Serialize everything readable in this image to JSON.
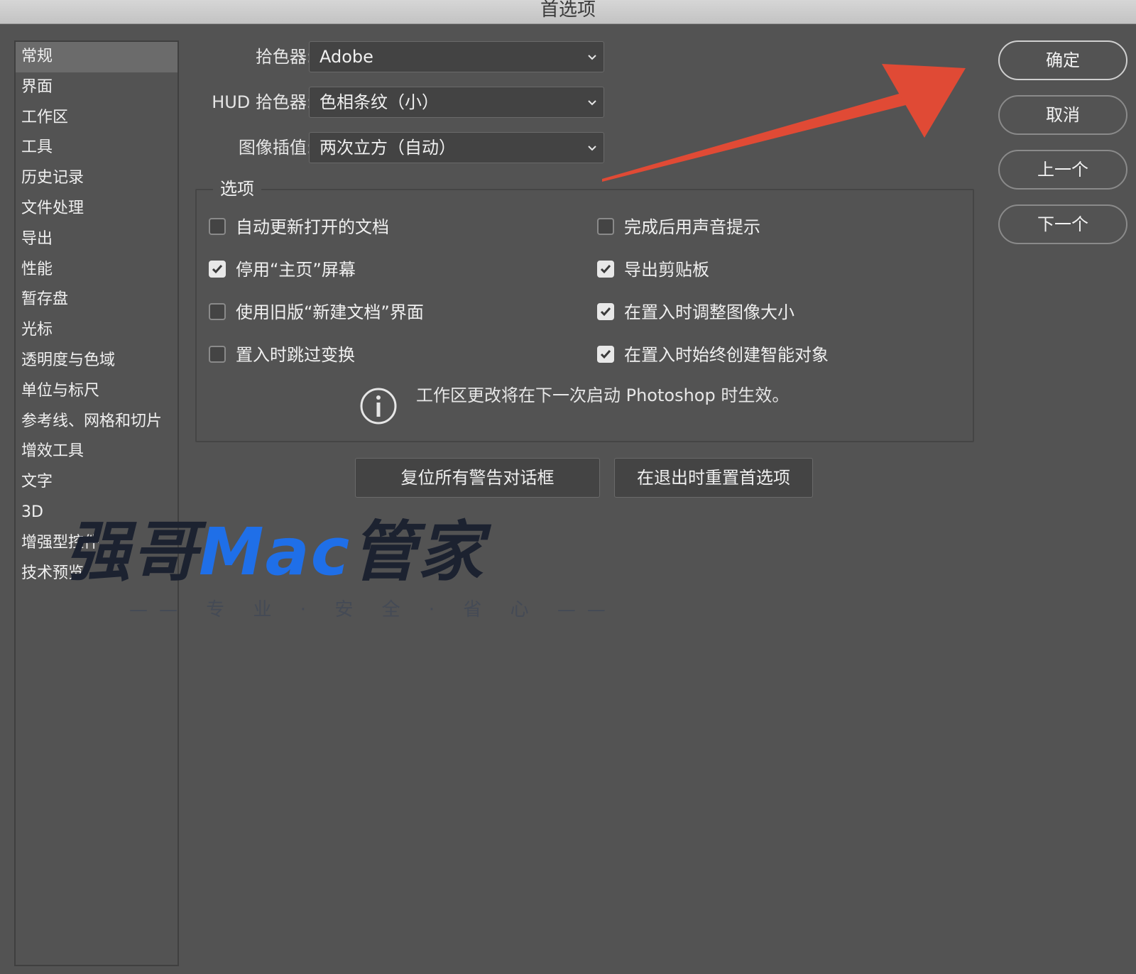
{
  "window": {
    "title": "首选项"
  },
  "sidebar": {
    "items": [
      {
        "label": "常规",
        "selected": true
      },
      {
        "label": "界面"
      },
      {
        "label": "工作区"
      },
      {
        "label": "工具"
      },
      {
        "label": "历史记录"
      },
      {
        "label": "文件处理"
      },
      {
        "label": "导出"
      },
      {
        "label": "性能"
      },
      {
        "label": "暂存盘"
      },
      {
        "label": "光标"
      },
      {
        "label": "透明度与色域"
      },
      {
        "label": "单位与标尺"
      },
      {
        "label": "参考线、网格和切片"
      },
      {
        "label": "增效工具"
      },
      {
        "label": "文字"
      },
      {
        "label": "3D"
      },
      {
        "label": "增强型控件"
      },
      {
        "label": "技术预览"
      }
    ]
  },
  "fields": {
    "color_picker": {
      "label": "拾色器:",
      "value": "Adobe"
    },
    "hud_color_picker": {
      "label": "HUD 拾色器:",
      "value": "色相条纹（小）"
    },
    "image_interpolation": {
      "label": "图像插值:",
      "value": "两次立方（自动）"
    }
  },
  "options": {
    "title": "选项",
    "auto_update_docs": {
      "label": "自动更新打开的文档",
      "checked": false
    },
    "disable_home_screen": {
      "label": "停用“主页”屏幕",
      "checked": true
    },
    "legacy_new_doc": {
      "label": "使用旧版“新建文档”界面",
      "checked": false
    },
    "skip_transform_on_place": {
      "label": "置入时跳过变换",
      "checked": false
    },
    "beep_when_done": {
      "label": "完成后用声音提示",
      "checked": false
    },
    "export_clipboard": {
      "label": "导出剪贴板",
      "checked": true
    },
    "resize_on_place": {
      "label": "在置入时调整图像大小",
      "checked": true
    },
    "always_smart_objects": {
      "label": "在置入时始终创建智能对象",
      "checked": true
    },
    "info_text": "工作区更改将在下一次启动 Photoshop 时生效。"
  },
  "actions": {
    "reset_warnings": "复位所有警告对话框",
    "reset_on_quit": "在退出时重置首选项"
  },
  "dialog_buttons": {
    "ok": "确定",
    "cancel": "取消",
    "prev": "上一个",
    "next": "下一个"
  },
  "watermark": {
    "text_part1": "强哥",
    "text_part2": "Mac",
    "text_part3": "管家",
    "tagline": "—— 专 业 · 安 全 · 省 心 ——"
  },
  "colors": {
    "background": "#535353",
    "annotation_arrow": "#e04a35",
    "watermark_blue": "#1f6fe8"
  }
}
